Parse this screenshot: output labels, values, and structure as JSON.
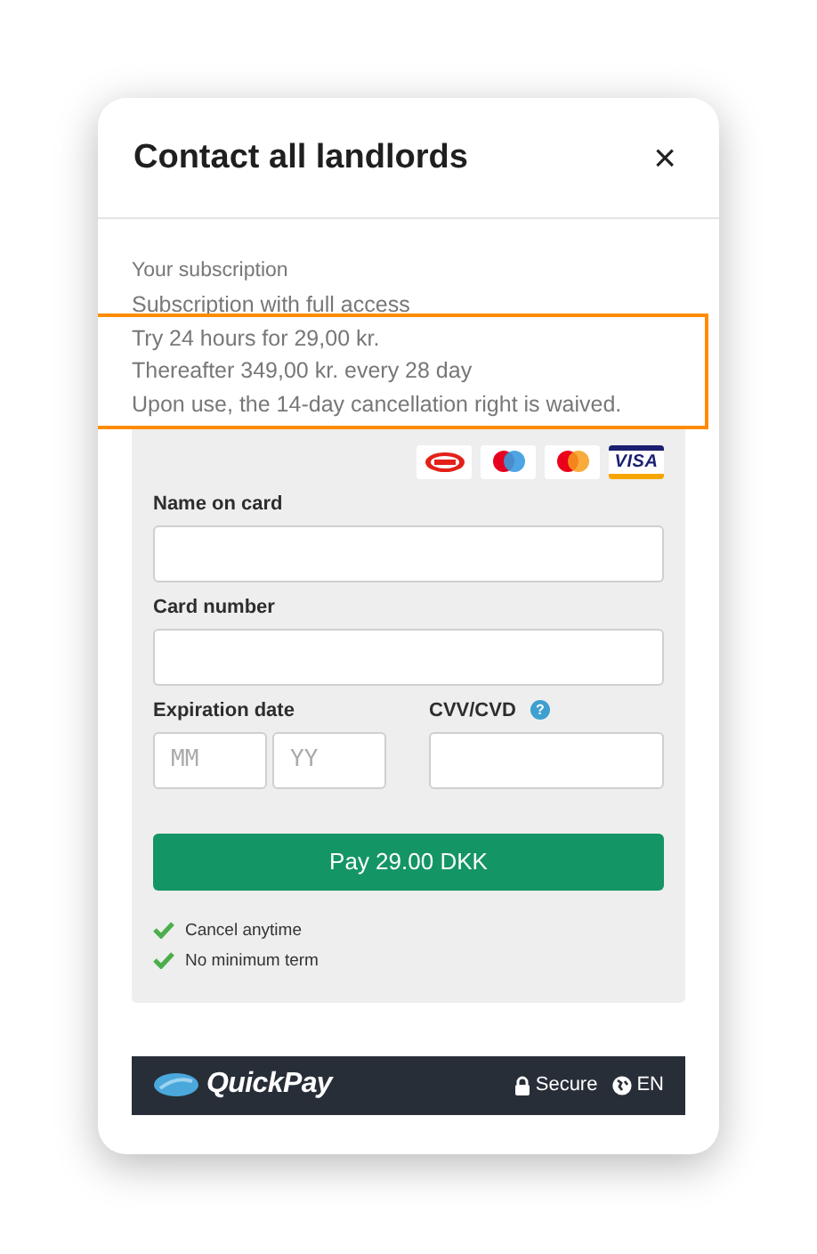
{
  "dialog": {
    "title": "Contact all landlords",
    "close": "×"
  },
  "subscription": {
    "lines": [
      {
        "text": "Your subscription",
        "highlighted": false
      },
      {
        "text": "Subscription with full access",
        "highlighted": false
      },
      {
        "text": "Try 24 hours for 29,00 kr.",
        "highlighted": true
      },
      {
        "text": "Thereafter 349,00 kr. every 28 day",
        "highlighted": true
      },
      {
        "text": "Upon use, the 14-day cancellation right is waived.",
        "highlighted": true
      }
    ]
  },
  "payment_form": {
    "card_logos": [
      {
        "kind": "dankort"
      },
      {
        "kind": "maestro"
      },
      {
        "kind": "mastercard"
      },
      {
        "kind": "visa",
        "text": "VISA"
      }
    ],
    "name_label": "Name on card",
    "number_label": "Card number",
    "expiry_label": "Expiration date",
    "month_placeholder": "MM",
    "year_placeholder": "YY",
    "cvv_label": "CVV/CVD",
    "cvv_help": "?",
    "pay_button": "Pay 29.00 DKK",
    "benefits": [
      "Cancel anytime",
      "No minimum term"
    ]
  },
  "footer": {
    "brand": "QuickPay",
    "secure": "Secure",
    "language": "EN"
  }
}
